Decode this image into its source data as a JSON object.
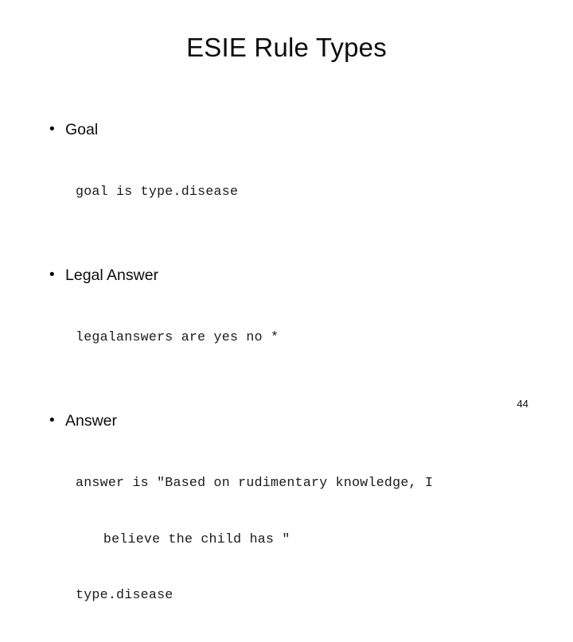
{
  "slide": {
    "title": "ESIE Rule Types",
    "page_number": "44",
    "bullet_glyph": "•",
    "colors": {
      "background": "#ffffff",
      "text": "#0c0c0c",
      "code_text": "#1a1a1a"
    },
    "blocks": [
      {
        "label": "Goal",
        "code": [
          {
            "text": "goal is type.disease",
            "indented": false
          }
        ]
      },
      {
        "label": "Legal Answer",
        "code": [
          {
            "text": "legalanswers are yes no *",
            "indented": false
          }
        ]
      },
      {
        "label": "Answer",
        "code": [
          {
            "text": "answer is \"Based on rudimentary knowledge, I",
            "indented": false
          },
          {
            "text": "believe the child has \"",
            "indented": true
          },
          {
            "text": "type.disease",
            "indented": false
          }
        ]
      }
    ]
  }
}
